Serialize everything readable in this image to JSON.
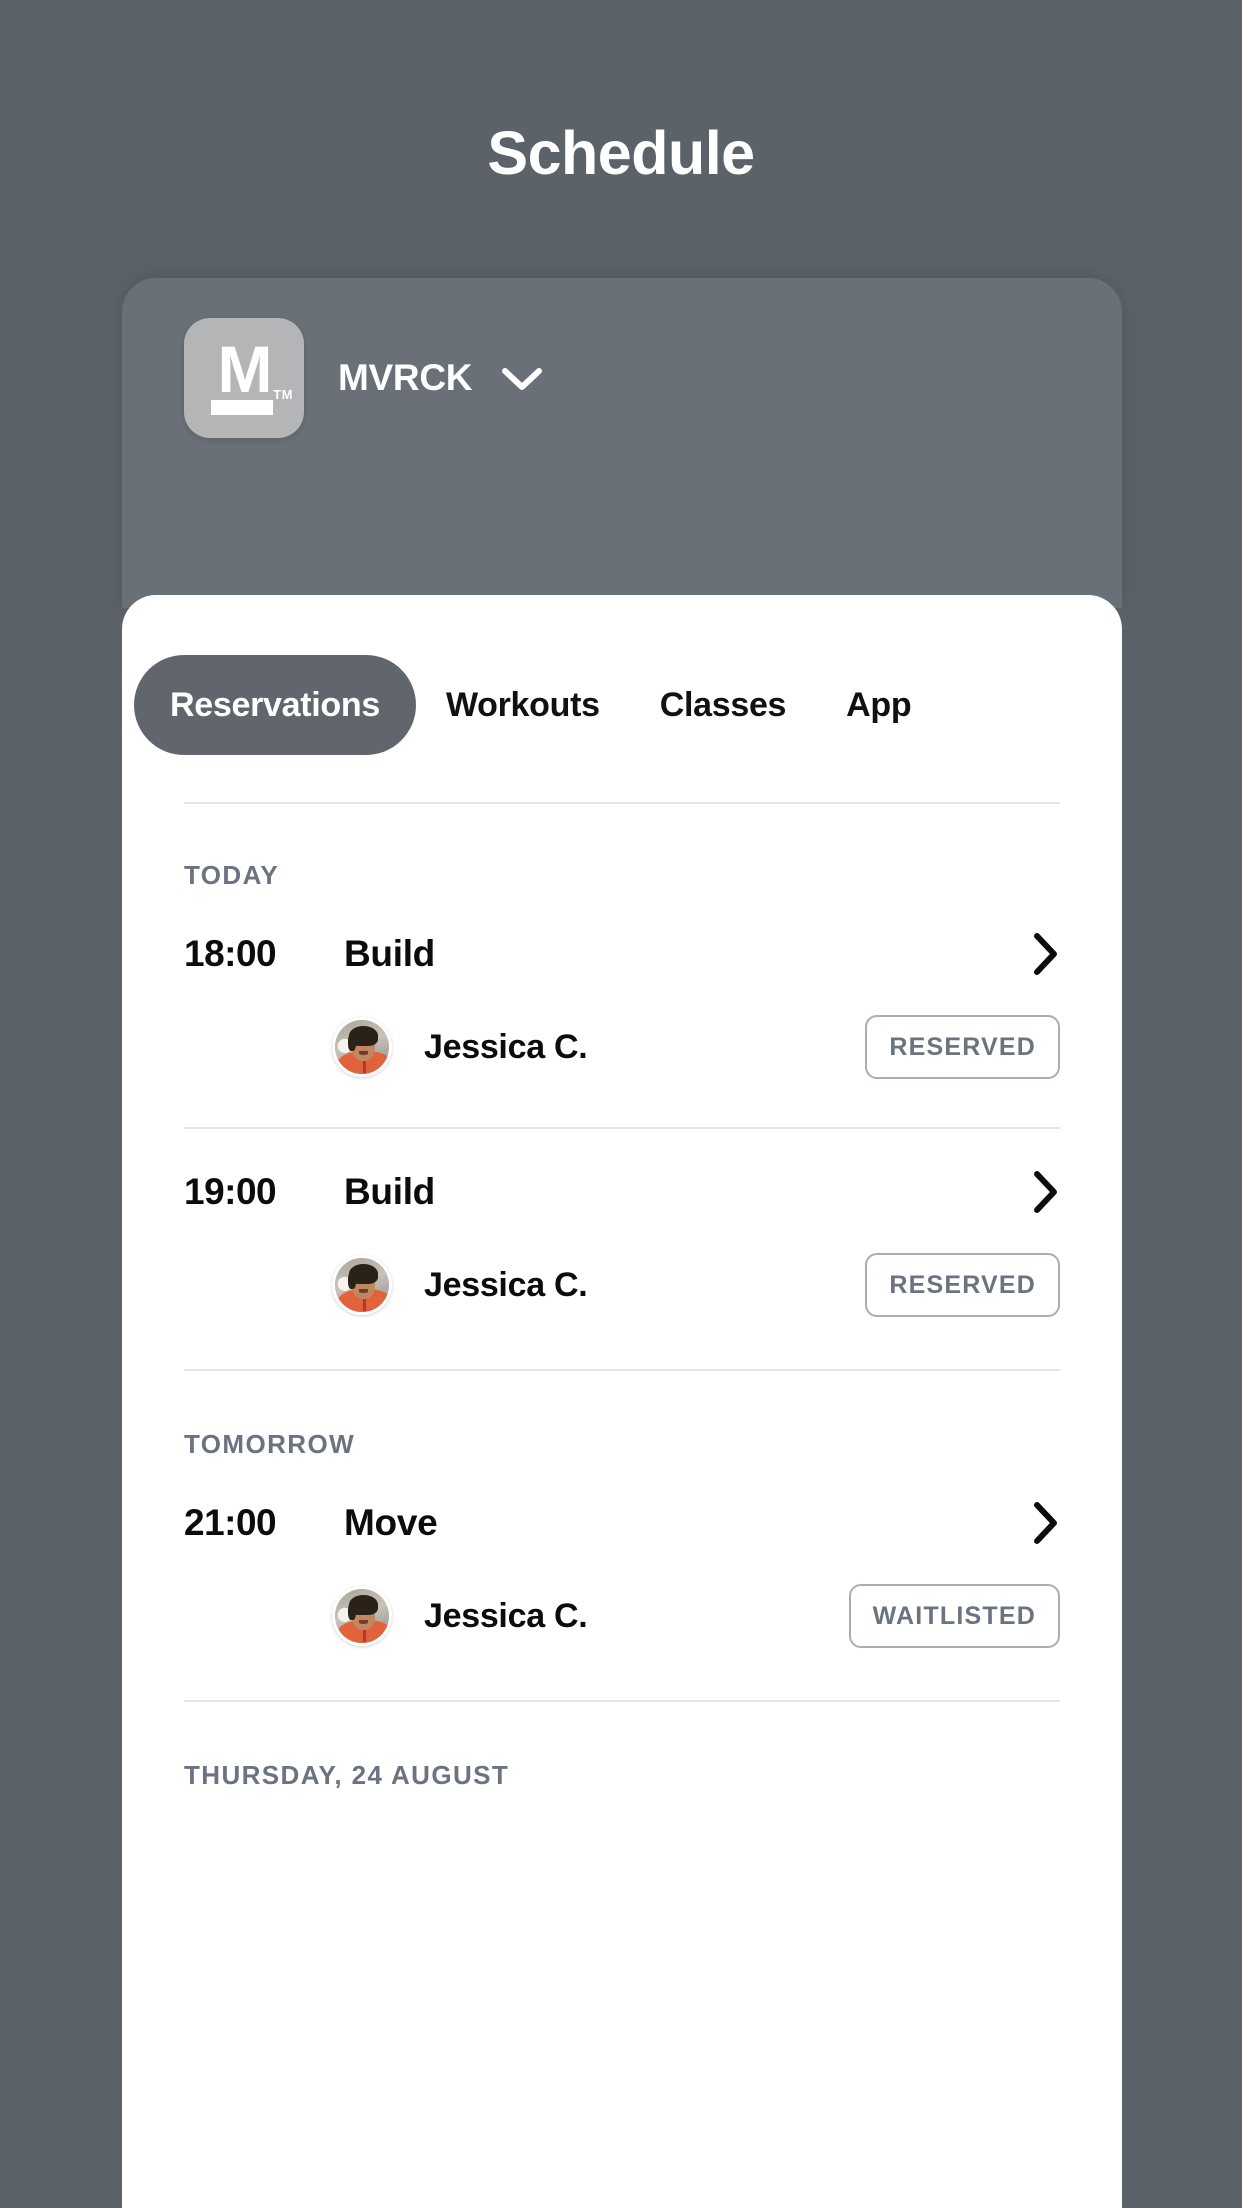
{
  "header": {
    "title": "Schedule"
  },
  "org": {
    "name": "MVRCK",
    "logo_letter": "M",
    "logo_tm": "TM",
    "chevron_icon": "chevron-down-icon"
  },
  "tabs": [
    {
      "label": "Reservations",
      "active": true
    },
    {
      "label": "Workouts",
      "active": false
    },
    {
      "label": "Classes",
      "active": false
    },
    {
      "label": "App",
      "active": false
    }
  ],
  "sections": [
    {
      "day_label": "TODAY",
      "classes": [
        {
          "time": "18:00",
          "name": "Build",
          "chevron_icon": "chevron-right-icon",
          "bookings": [
            {
              "member": "Jessica C.",
              "status": "RESERVED",
              "avatar": "member-avatar"
            }
          ]
        },
        {
          "time": "19:00",
          "name": "Build",
          "chevron_icon": "chevron-right-icon",
          "bookings": [
            {
              "member": "Jessica C.",
              "status": "RESERVED",
              "avatar": "member-avatar"
            }
          ]
        }
      ]
    },
    {
      "day_label": "TOMORROW",
      "classes": [
        {
          "time": "21:00",
          "name": "Move",
          "chevron_icon": "chevron-right-icon",
          "bookings": [
            {
              "member": "Jessica C.",
              "status": "WAITLISTED",
              "avatar": "member-avatar"
            }
          ]
        }
      ]
    },
    {
      "day_label": "THURSDAY, 24 AUGUST",
      "classes": []
    }
  ],
  "colors": {
    "page_background": "#5c6269",
    "org_card": "#6a7077",
    "sheet": "#ffffff",
    "active_tab": "#61666e",
    "day_label": "#6b7280",
    "badge_border": "#a9adb6",
    "badge_text": "#6b7280",
    "divider": "#e2e4e7",
    "logo_tile": "#b3b5b7"
  }
}
